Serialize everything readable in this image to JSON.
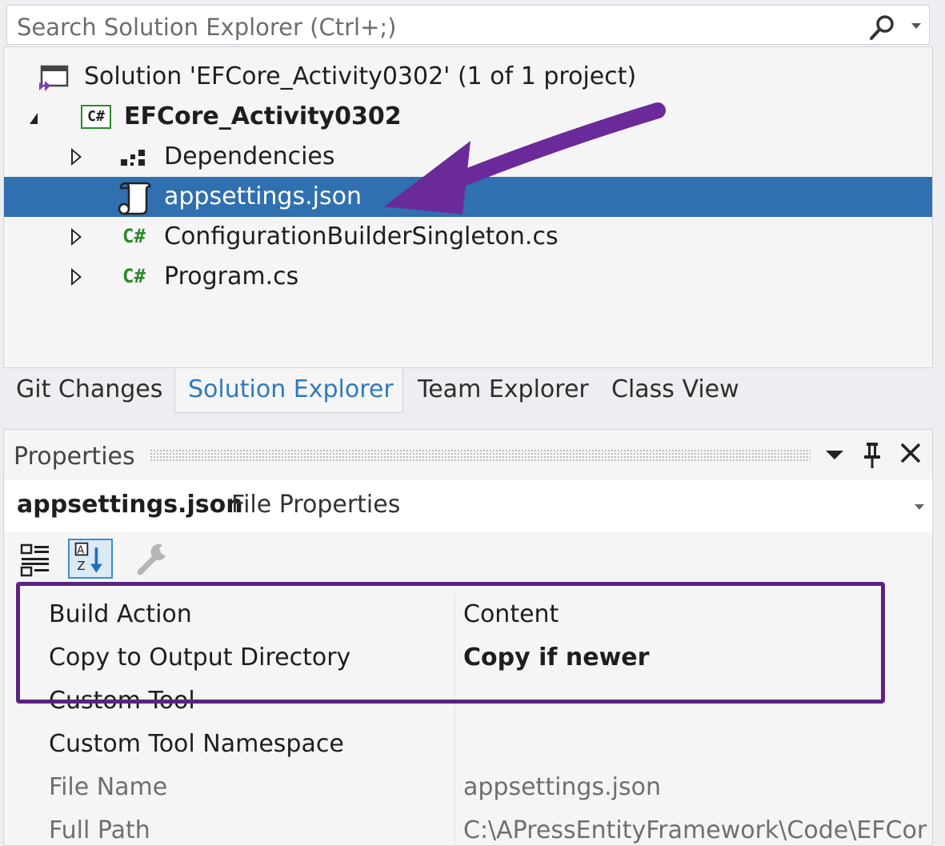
{
  "search": {
    "placeholder": "Search Solution Explorer (Ctrl+;)"
  },
  "tree": {
    "solution": "Solution 'EFCore_Activity0302' (1 of 1 project)",
    "project": "EFCore_Activity0302",
    "project_icon": "C#",
    "items": [
      {
        "label": "Dependencies",
        "icon": "dependencies-icon"
      },
      {
        "label": "appsettings.json",
        "icon": "json-file-icon",
        "selected": true
      },
      {
        "label": "ConfigurationBuilderSingleton.cs",
        "icon": "csharp-file-icon"
      },
      {
        "label": "Program.cs",
        "icon": "csharp-file-icon"
      }
    ],
    "cs_glyph": "C#"
  },
  "tabs": [
    {
      "label": "Git Changes"
    },
    {
      "label": "Solution Explorer",
      "active": true
    },
    {
      "label": "Team Explorer"
    },
    {
      "label": "Class View"
    }
  ],
  "properties": {
    "title": "Properties",
    "object_name": "appsettings.json",
    "object_type": "File Properties",
    "rows": [
      {
        "name": "Build Action",
        "value": "Content"
      },
      {
        "name": "Copy to Output Directory",
        "value": "Copy if newer"
      },
      {
        "name": "Custom Tool",
        "value": ""
      },
      {
        "name": "Custom Tool Namespace",
        "value": ""
      },
      {
        "name": "File Name",
        "value": "appsettings.json"
      },
      {
        "name": "Full Path",
        "value": "C:\\APressEntityFramework\\Code\\EFCor"
      }
    ]
  },
  "colors": {
    "selection": "#3070b0",
    "annotation": "#5b2380",
    "active_tab_text": "#2f7bbf",
    "csharp_green": "#2b8a2b"
  }
}
